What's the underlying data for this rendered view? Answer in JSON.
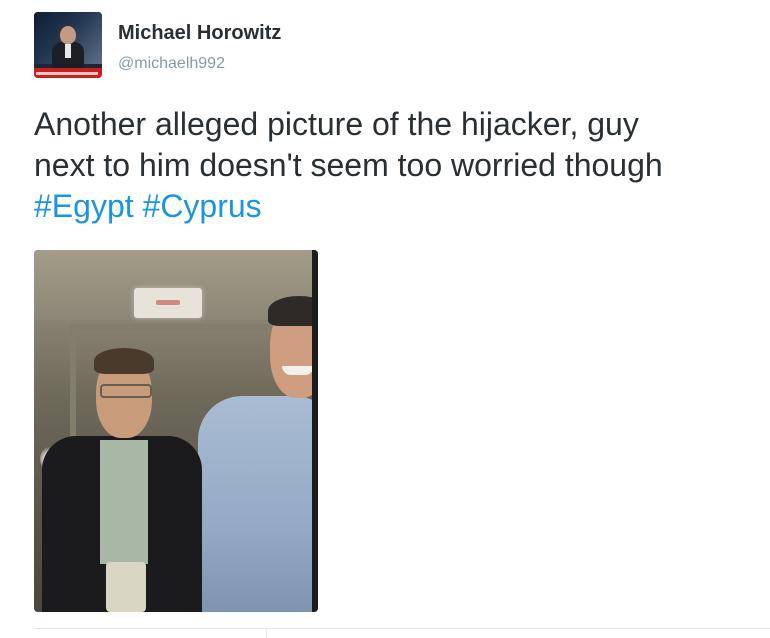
{
  "tweet": {
    "author": {
      "name": "Michael Horowitz",
      "handle": "@michaelh992"
    },
    "text": {
      "line1": "Another alleged picture of the hijacker, guy",
      "line2": "next to him doesn't seem too worried though",
      "hashtags": [
        "#Egypt",
        "#Cyprus"
      ]
    }
  },
  "colors": {
    "hashtag": "#1b95e0",
    "name": "#292f33",
    "handle": "#8899a6"
  },
  "icons": {
    "avatar": "profile-photo"
  }
}
